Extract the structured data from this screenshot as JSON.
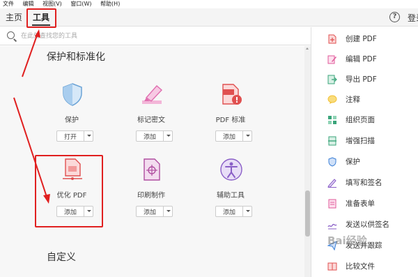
{
  "menubar": {
    "items": [
      "文件",
      "编辑",
      "视图(V)",
      "窗口(W)",
      "帮助(H)"
    ]
  },
  "tabs": {
    "home": "主页",
    "tools": "工具"
  },
  "header": {
    "help_symbol": "?",
    "login": "登录"
  },
  "search": {
    "placeholder": "在此处查找您的工具"
  },
  "sections": {
    "protect_title": "保护和标准化",
    "custom_title": "自定义"
  },
  "tools": [
    {
      "label": "保护",
      "button": "打开",
      "icon": "shield-icon",
      "color": "#6ba3d6"
    },
    {
      "label": "标记密文",
      "button": "添加",
      "icon": "marker-icon",
      "color": "#e06fb0"
    },
    {
      "label": "PDF 标准",
      "button": "添加",
      "icon": "pdf-standard-icon",
      "color": "#e05050"
    },
    {
      "label": "优化 PDF",
      "button": "添加",
      "icon": "optimize-pdf-icon",
      "color": "#e05050"
    },
    {
      "label": "印刷制作",
      "button": "添加",
      "icon": "print-production-icon",
      "color": "#b04ea0"
    },
    {
      "label": "辅助工具",
      "button": "添加",
      "icon": "accessibility-icon",
      "color": "#8a5fc7"
    }
  ],
  "right_panel": {
    "items": [
      {
        "label": "创建 PDF",
        "icon": "create-pdf-icon",
        "color": "#e05050"
      },
      {
        "label": "编辑 PDF",
        "icon": "edit-pdf-icon",
        "color": "#e05a9a"
      },
      {
        "label": "导出 PDF",
        "icon": "export-pdf-icon",
        "color": "#3aa47a"
      },
      {
        "label": "注释",
        "icon": "comment-icon",
        "color": "#f2c23a"
      },
      {
        "label": "组织页面",
        "icon": "organize-pages-icon",
        "color": "#3aa47a"
      },
      {
        "label": "增强扫描",
        "icon": "enhance-scan-icon",
        "color": "#3aa47a"
      },
      {
        "label": "保护",
        "icon": "protect-icon",
        "color": "#3b7fd6"
      },
      {
        "label": "填写和签名",
        "icon": "fill-sign-icon",
        "color": "#8a5fc7"
      },
      {
        "label": "准备表单",
        "icon": "prepare-form-icon",
        "color": "#e05a9a"
      },
      {
        "label": "发送以供签名",
        "icon": "send-sign-icon",
        "color": "#8a5fc7"
      },
      {
        "label": "发送并跟踪",
        "icon": "send-track-icon",
        "color": "#3b7fd6"
      },
      {
        "label": "比较文件",
        "icon": "compare-icon",
        "color": "#e05050"
      }
    ]
  },
  "annotation": {
    "color": "#e02020",
    "watermark": "Bai经验"
  }
}
